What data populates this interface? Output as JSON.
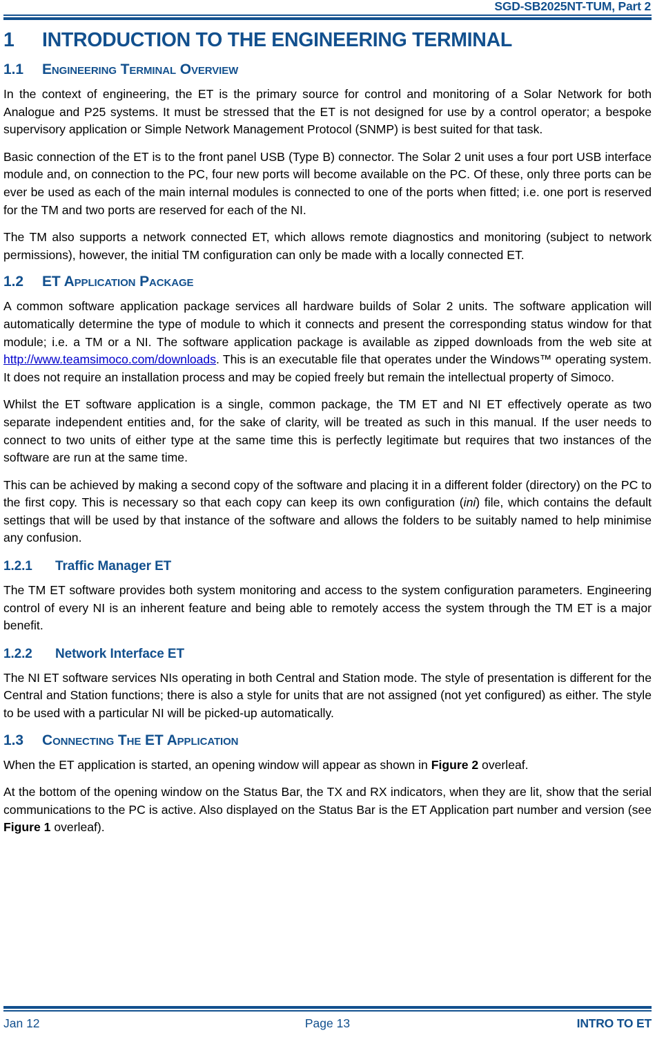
{
  "header": {
    "doc_ref": "SGD-SB2025NT-TUM, Part 2"
  },
  "footer": {
    "date": "Jan 12",
    "page": "Page 13",
    "section_ref": "INTRO TO ET"
  },
  "colors": {
    "heading_blue": "#12508E",
    "link_blue": "#0000CC",
    "body_black": "#000000"
  },
  "chapter": {
    "number": "1",
    "title": "INTRODUCTION TO THE ENGINEERING TERMINAL"
  },
  "sections": {
    "s11": {
      "number": "1.1",
      "title": "Engineering Terminal Overview",
      "p1": "In the context of engineering, the ET is the primary source for control and monitoring of a Solar Network for both Analogue and P25 systems.  It must be stressed that the ET is not designed for use by a control operator; a bespoke supervisory application or Simple Network Management Protocol (SNMP) is best suited for that task.",
      "p2": "Basic connection of the ET is to the front panel USB (Type B) connector.  The Solar 2 unit uses a four port USB interface module and, on connection to the PC, four new ports will become available on the PC.  Of these, only three ports can be ever be used as each of the main internal modules is connected to one of the ports when fitted; i.e. one port is reserved for the TM and two ports are reserved for each of the NI.",
      "p3": "The TM also supports a network connected ET, which allows remote diagnostics and monitoring (subject to network permissions), however, the initial TM configuration can only be made with a locally connected ET."
    },
    "s12": {
      "number": "1.2",
      "title": "ET Application Package",
      "p1_before_link": "A common software application package services all hardware builds of Solar 2 units.  The software application will automatically determine the type of module to which it connects and present the corresponding status window for that module; i.e. a TM or a NI.  The software application package is available as zipped downloads from the web site at ",
      "p1_link": "http://www.teamsimoco.com/downloads",
      "p1_after_link": ".  This is an executable file that operates under the Windows™ operating system.  It does not require an installation process and may be copied freely but remain the intellectual property of Simoco.",
      "p2": "Whilst the ET software application is a single, common package, the TM ET and NI ET effectively operate as two separate independent entities and, for the sake of clarity, will be treated as such in this manual.  If the user needs to connect to two units of either type at the same time this is perfectly legitimate but requires that two instances of the software are run at the same time.",
      "p3_before_ital": "This can be achieved by making a second copy of the software and placing it in a different folder (directory) on the PC to the first copy.  This is necessary so that each copy can keep its own configuration (",
      "p3_ital": "ini",
      "p3_after_ital": ") file, which contains the default settings that will be used by that instance of the software and allows the folders to be suitably named to help minimise any confusion."
    },
    "s121": {
      "number": "1.2.1",
      "title": "Traffic Manager ET",
      "p1": "The TM ET software provides both system monitoring and access to the system configuration parameters.  Engineering control of every NI is an inherent feature and being able to remotely access the system through the TM ET is a major benefit."
    },
    "s122": {
      "number": "1.2.2",
      "title": "Network Interface ET",
      "p1": "The NI ET software services NIs operating in both Central and Station mode.  The style of presentation is different for the Central and Station functions; there is also a style for units that are not assigned (not yet configured) as either.  The style to be used with a particular NI will be picked-up automatically."
    },
    "s13": {
      "number": "1.3",
      "title": "Connecting The ET Application",
      "p1_before_bold": "When the ET application is started, an opening window will appear as shown in ",
      "p1_bold": "Figure 2",
      "p1_after_bold": " overleaf.",
      "p2_before_bold": "At the bottom of the opening window on the Status Bar, the TX and RX indicators, when they are lit, show that the serial communications to the PC is active.  Also displayed on the Status Bar is the ET Application part number and version (see ",
      "p2_bold": "Figure 1",
      "p2_after_bold": " overleaf)."
    }
  }
}
